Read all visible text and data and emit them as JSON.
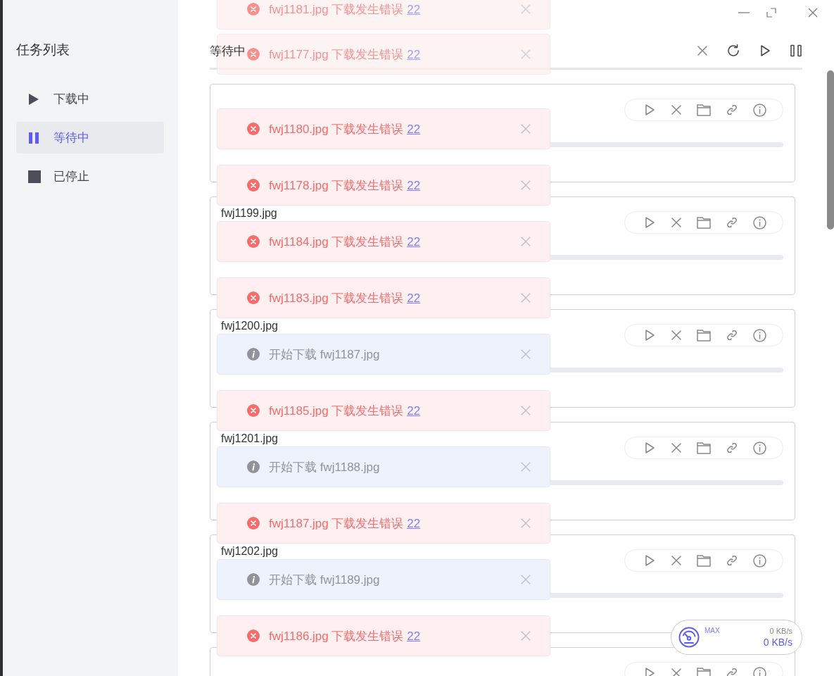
{
  "sidebar": {
    "title": "任务列表",
    "items": [
      {
        "kind": "play",
        "label": "下载中",
        "selected": false
      },
      {
        "kind": "pause",
        "label": "等待中",
        "selected": true
      },
      {
        "kind": "stop",
        "label": "已停止",
        "selected": false
      }
    ]
  },
  "header": {
    "title": "等待中"
  },
  "tasks": [
    {
      "kind": "file",
      "level": 0
    },
    {
      "kind": "file",
      "name": "fwj1199.jpg",
      "level": 0
    },
    {
      "kind": "file",
      "name": "fwj1200.jpg",
      "level": 0
    },
    {
      "kind": "file",
      "name": "fwj1201.jpg",
      "level": 0
    },
    {
      "kind": "file",
      "name": "fwj1202.jpg",
      "level": 0
    },
    {
      "kind": "file"
    }
  ],
  "toasts": [
    {
      "kind": "error",
      "message": "fwj1181.jpg 下载发生错误",
      "link": "22",
      "fading": true
    },
    {
      "kind": "error",
      "message": "fwj1177.jpg 下载发生错误",
      "link": "22",
      "fading": true
    },
    {
      "kind": "error",
      "message": "fwj1180.jpg 下载发生错误",
      "link": "22",
      "fading": false
    },
    {
      "kind": "error",
      "message": "fwj1178.jpg 下载发生错误",
      "link": "22",
      "fading": false
    },
    {
      "kind": "error",
      "message": "fwj1184.jpg 下载发生错误",
      "link": "22",
      "fading": false
    },
    {
      "kind": "error",
      "message": "fwj1183.jpg 下载发生错误",
      "link": "22",
      "fading": false
    },
    {
      "kind": "info",
      "message": "开始下载 fwj1187.jpg",
      "fading": false
    },
    {
      "kind": "error",
      "message": "fwj1185.jpg 下载发生错误",
      "link": "22",
      "fading": false
    },
    {
      "kind": "info",
      "message": "开始下载 fwj1188.jpg",
      "fading": false
    },
    {
      "kind": "error",
      "message": "fwj1187.jpg 下载发生错误",
      "link": "22",
      "fading": false
    },
    {
      "kind": "info",
      "message": "开始下载 fwj1189.jpg",
      "fading": false
    },
    {
      "kind": "error",
      "message": "fwj1186.jpg 下载发生错误",
      "link": "22",
      "fading": false
    }
  ],
  "speed": {
    "limit": "MAX",
    "upload": "0 KB/s",
    "download": "0 KB/s"
  }
}
